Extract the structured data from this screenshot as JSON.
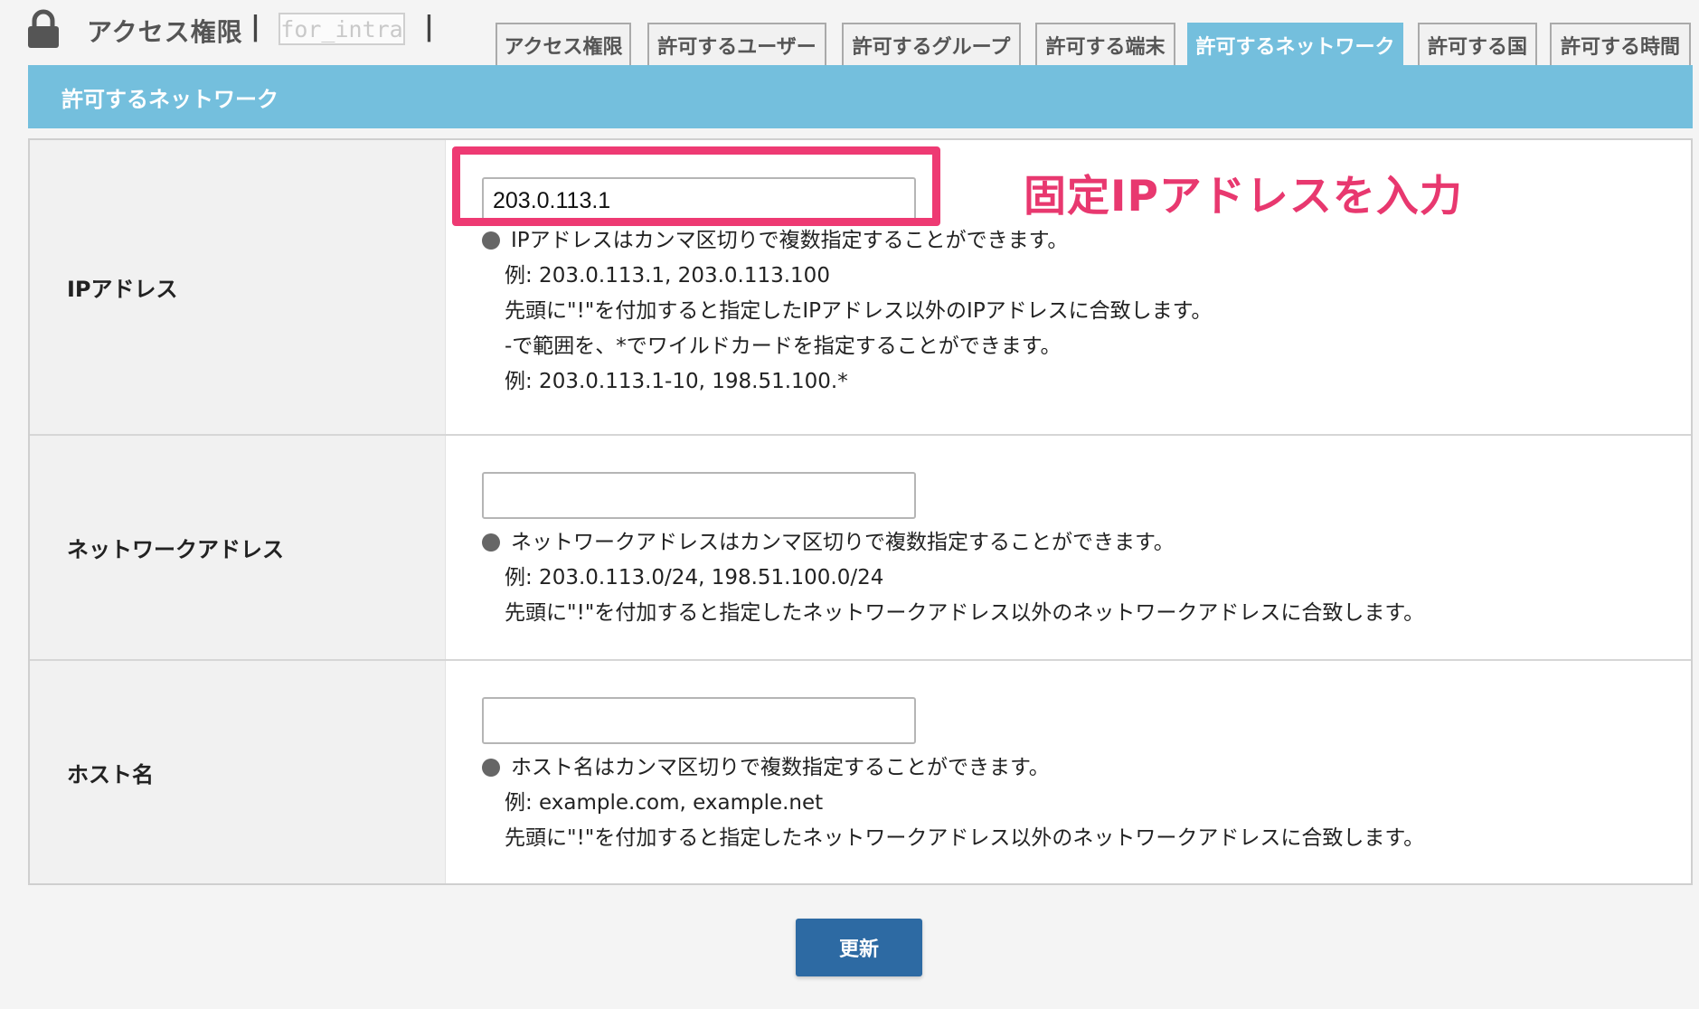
{
  "header": {
    "title": "アクセス権限",
    "site_name": "for_intra",
    "separator": "|"
  },
  "tabs": [
    {
      "label": "アクセス権限",
      "active": false
    },
    {
      "label": "許可するユーザー",
      "active": false
    },
    {
      "label": "許可するグループ",
      "active": false
    },
    {
      "label": "許可する端末",
      "active": false
    },
    {
      "label": "許可するネットワーク",
      "active": true
    },
    {
      "label": "許可する国",
      "active": false
    },
    {
      "label": "許可する時間",
      "active": false
    }
  ],
  "section": {
    "title": "許可するネットワーク"
  },
  "form": {
    "ip": {
      "label": "IPアドレス",
      "value": "203.0.113.1",
      "help": [
        "IPアドレスはカンマ区切りで複数指定することができます。",
        "例: 203.0.113.1, 203.0.113.100",
        "先頭に\"!\"を付加すると指定したIPアドレス以外のIPアドレスに合致します。",
        "-で範囲を、*でワイルドカードを指定することができます。",
        "例: 203.0.113.1-10, 198.51.100.*"
      ]
    },
    "network": {
      "label": "ネットワークアドレス",
      "value": "",
      "help": [
        "ネットワークアドレスはカンマ区切りで複数指定することができます。",
        "例: 203.0.113.0/24, 198.51.100.0/24",
        "先頭に\"!\"を付加すると指定したネットワークアドレス以外のネットワークアドレスに合致します。"
      ]
    },
    "host": {
      "label": "ホスト名",
      "value": "",
      "help": [
        "ホスト名はカンマ区切りで複数指定することができます。",
        "例: example.com, example.net",
        "先頭に\"!\"を付加すると指定したネットワークアドレス以外のネットワークアドレスに合致します。"
      ]
    }
  },
  "annotation": {
    "text": "固定IPアドレスを入力"
  },
  "submit_label": "更新",
  "colors": {
    "accent": "#74bfdd",
    "highlight": "#ee3a73",
    "button": "#2d6aa3"
  },
  "icons": {
    "lock": "lock-icon",
    "bullet": "bullet-icon"
  }
}
